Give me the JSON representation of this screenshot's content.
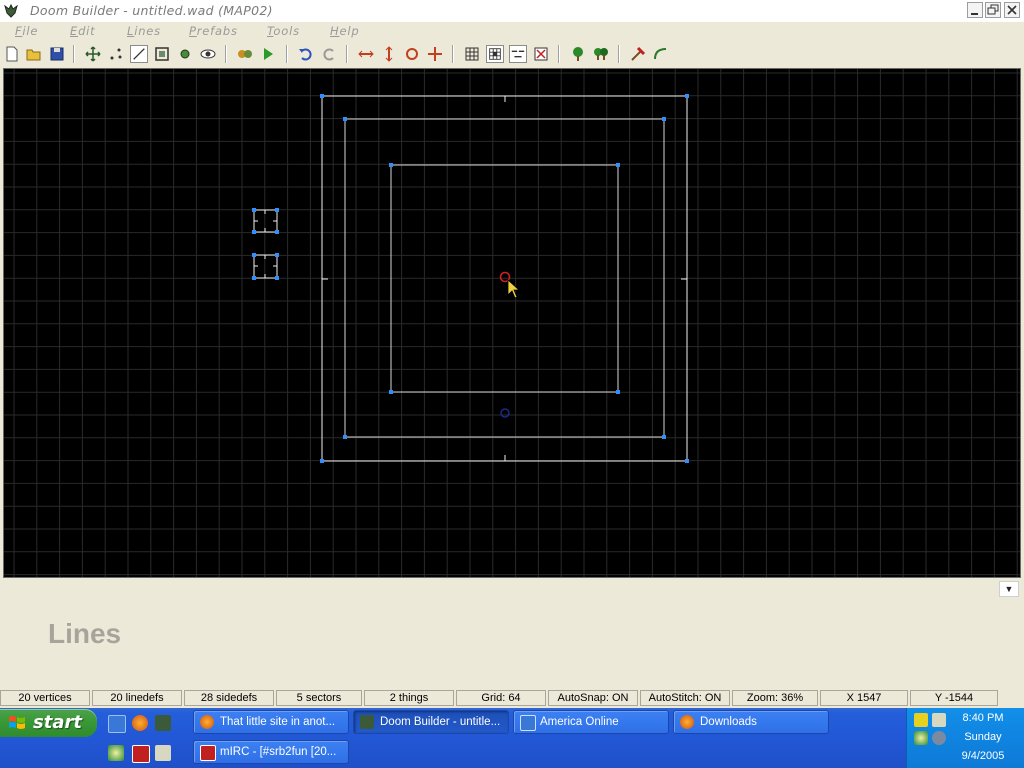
{
  "window": {
    "title": "Doom Builder - untitled.wad (MAP02)"
  },
  "menubar": {
    "items": [
      {
        "key": "F",
        "rest": "ile"
      },
      {
        "key": "E",
        "rest": "dit"
      },
      {
        "key": "L",
        "rest": "ines"
      },
      {
        "key": "P",
        "rest": "refabs"
      },
      {
        "key": "T",
        "rest": "ools"
      },
      {
        "key": "H",
        "rest": "elp"
      }
    ]
  },
  "toolbar": {
    "icons": [
      "new-file-icon",
      "open-file-icon",
      "save-icon",
      "move-mode-icon",
      "vertices-mode-icon",
      "lines-mode-icon",
      "sectors-mode-icon",
      "things-mode-icon",
      "3d-mode-icon",
      "build-nodes-icon",
      "test-map-icon",
      "undo-icon",
      "redo-icon",
      "flip-lines-icon",
      "flip-sidedefs-icon",
      "rotate-icon",
      "resize-icon",
      "grid-icon",
      "snap-grid-icon",
      "stitch-icon",
      "clear-icon",
      "tree-icon",
      "trees-icon",
      "hammer-icon",
      "curve-icon"
    ],
    "pressed": "lines-mode-icon"
  },
  "info_panel": {
    "mode_title": "Lines"
  },
  "statusbar": {
    "vertices": "20 vertices",
    "linedefs": "20 linedefs",
    "sidedefs": "28 sidedefs",
    "sectors": "5 sectors",
    "things": "2 things",
    "grid": "Grid: 64",
    "autosnap": "AutoSnap: ON",
    "autostitch": "AutoStitch: ON",
    "zoom": "Zoom: 36%",
    "x": "X 1547",
    "y": "Y -1544"
  },
  "taskbar": {
    "start_label": "start",
    "tasks": [
      {
        "label": "That little site in anot...",
        "active": false
      },
      {
        "label": "Doom Builder - untitle...",
        "active": true
      },
      {
        "label": "America  Online",
        "active": false
      },
      {
        "label": "Downloads",
        "active": false
      },
      {
        "label": "mIRC - [#srb2fun [20...",
        "active": false
      }
    ],
    "clock": {
      "time": "8:40 PM",
      "day": "Sunday",
      "date": "9/4/2005"
    }
  },
  "colors": {
    "map_background": "#000000",
    "grid": "#2a2a2a",
    "line": "#ffffff",
    "vertex": "#2f8fff",
    "thing_red": "#cc2222",
    "thing_blue": "#1a2a8a"
  }
}
